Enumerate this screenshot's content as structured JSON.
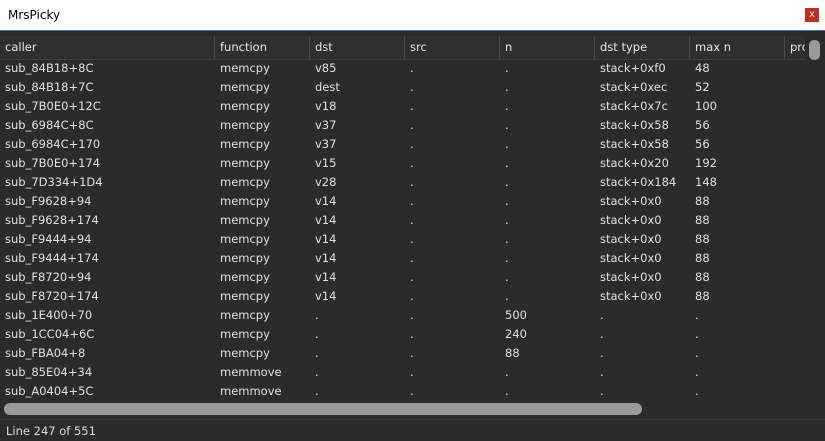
{
  "window": {
    "title": "MrsPicky",
    "close_label": "x"
  },
  "table": {
    "columns": [
      "caller",
      "function",
      "dst",
      "src",
      "n",
      "dst type",
      "max n",
      "pro"
    ],
    "rows": [
      [
        "sub_84B18+8C",
        "memcpy",
        "v85",
        ".",
        ".",
        "stack+0xf0",
        "48"
      ],
      [
        "sub_84B18+7C",
        "memcpy",
        "dest",
        ".",
        ".",
        "stack+0xec",
        "52"
      ],
      [
        "sub_7B0E0+12C",
        "memcpy",
        "v18",
        ".",
        ".",
        "stack+0x7c",
        "100"
      ],
      [
        "sub_6984C+8C",
        "memcpy",
        "v37",
        ".",
        ".",
        "stack+0x58",
        "56"
      ],
      [
        "sub_6984C+170",
        "memcpy",
        "v37",
        ".",
        ".",
        "stack+0x58",
        "56"
      ],
      [
        "sub_7B0E0+174",
        "memcpy",
        "v15",
        ".",
        ".",
        "stack+0x20",
        "192"
      ],
      [
        "sub_7D334+1D4",
        "memcpy",
        "v28",
        ".",
        ".",
        "stack+0x184",
        "148"
      ],
      [
        "sub_F9628+94",
        "memcpy",
        "v14",
        ".",
        ".",
        "stack+0x0",
        "88"
      ],
      [
        "sub_F9628+174",
        "memcpy",
        "v14",
        ".",
        ".",
        "stack+0x0",
        "88"
      ],
      [
        "sub_F9444+94",
        "memcpy",
        "v14",
        ".",
        ".",
        "stack+0x0",
        "88"
      ],
      [
        "sub_F9444+174",
        "memcpy",
        "v14",
        ".",
        ".",
        "stack+0x0",
        "88"
      ],
      [
        "sub_F8720+94",
        "memcpy",
        "v14",
        ".",
        ".",
        "stack+0x0",
        "88"
      ],
      [
        "sub_F8720+174",
        "memcpy",
        "v14",
        ".",
        ".",
        "stack+0x0",
        "88"
      ],
      [
        "sub_1E400+70",
        "memcpy",
        ".",
        ".",
        "500",
        ".",
        "."
      ],
      [
        "sub_1CC04+6C",
        "memcpy",
        ".",
        ".",
        "240",
        ".",
        "."
      ],
      [
        "sub_FBA04+8",
        "memcpy",
        ".",
        ".",
        "88",
        ".",
        "."
      ],
      [
        "sub_85E04+34",
        "memmove",
        ".",
        ".",
        ".",
        ".",
        "."
      ],
      [
        "sub_A0404+5C",
        "memmove",
        ".",
        ".",
        ".",
        ".",
        "."
      ]
    ]
  },
  "status": {
    "text": "Line 247 of 551"
  }
}
